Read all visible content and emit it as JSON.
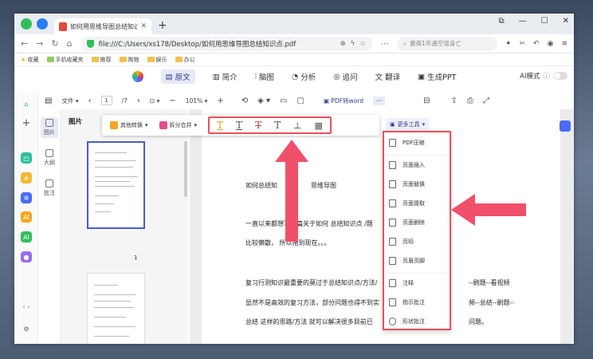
{
  "browser": {
    "tab_title": "如何用思维导图总结知识点.pd",
    "url": "file:///C:/Users/xs178/Desktop/如何用思维导图总结知识点.pdf",
    "search_placeholder": "惠商1年遇空增身亡",
    "bookmarks": [
      "收藏",
      "手机收藏夹",
      "推荐",
      "购物",
      "娱乐",
      "办公"
    ]
  },
  "app_nav": {
    "items": [
      "原文",
      "简介",
      "脑图",
      "分析",
      "追问",
      "翻译",
      "生成PPT"
    ],
    "active": "原文",
    "ai_mode": "AI模式"
  },
  "toolbar": {
    "file": "文件",
    "page_current": "1",
    "page_total": "/7",
    "zoom": "101%",
    "pdf_to_word": "PDF转word",
    "more": "···"
  },
  "sidebar": {
    "items": [
      "图片",
      "大纲",
      "批注"
    ],
    "panel_title": "图片",
    "page_number": "1"
  },
  "floating_toolbar": {
    "convert": "其他转换",
    "split_merge": "拆分合并",
    "more_tools": "更多工具"
  },
  "menu": {
    "items": [
      "PDF压缩",
      "页面插入",
      "页面替换",
      "页面提取",
      "页面删除",
      "页码",
      "页眉页脚",
      "注释",
      "指示批注",
      "形状批注"
    ]
  },
  "document": {
    "line1a": "如何总结知",
    "line1b": "思维导图",
    "line2a": "一直以来都想写一篇关于如何 总结知识点 /题",
    "line3": "比较懒散， 所以拖到现在。。。",
    "line4a": "复习行测知识最重要的莫过于总结知识点/方法/",
    "line4b": "--刷题--看视频",
    "line5a": "显然不是高效的复习方法，部分问题也得不到实",
    "line5b": "频--总结--刷题--",
    "line6a": "总结 这样的思路/方法 就可以解决很多目前已",
    "line6b": "问题。"
  },
  "colors": {
    "accent": "#e9505b",
    "brand": "#2f3a8f"
  }
}
